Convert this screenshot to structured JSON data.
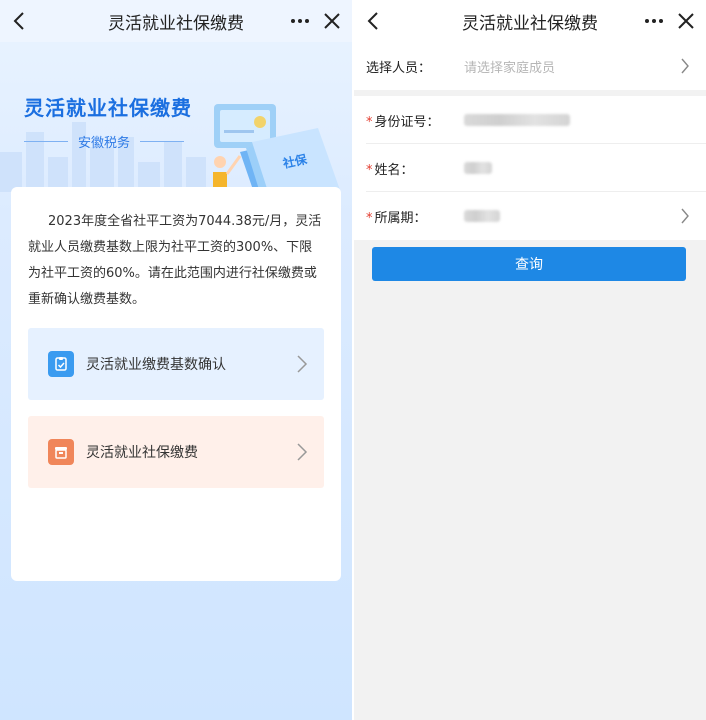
{
  "left": {
    "header": {
      "title": "灵活就业社保缴费"
    },
    "hero": {
      "title": "灵活就业社保缴费",
      "subtitle": "安徽税务",
      "badge_text": "社保"
    },
    "description": "2023年度全省社平工资为7044.38元/月，灵活就业人员缴费基数上限为社平工资的300%、下限为社平工资的60%。请在此范围内进行社保缴费或重新确认缴费基数。",
    "menu": [
      {
        "label": "灵活就业缴费基数确认",
        "icon": "clipboard-check-icon",
        "color": "#3a9bf0",
        "bg": "#e6f1ff"
      },
      {
        "label": "灵活就业社保缴费",
        "icon": "box-icon",
        "color": "#f0865a",
        "bg": "#fff0ea"
      }
    ]
  },
  "right": {
    "header": {
      "title": "灵活就业社保缴费"
    },
    "form": {
      "select_person": {
        "label": "选择人员：",
        "placeholder": "请选择家庭成员"
      },
      "id_number": {
        "label": "身份证号：",
        "value": ""
      },
      "name": {
        "label": "姓名：",
        "value": ""
      },
      "period": {
        "label": "所属期：",
        "value": ""
      }
    },
    "query_button": "查询"
  },
  "colors": {
    "primary": "#1e88e5",
    "required_star": "#e23b2e",
    "hero_title": "#1b6fe0"
  }
}
